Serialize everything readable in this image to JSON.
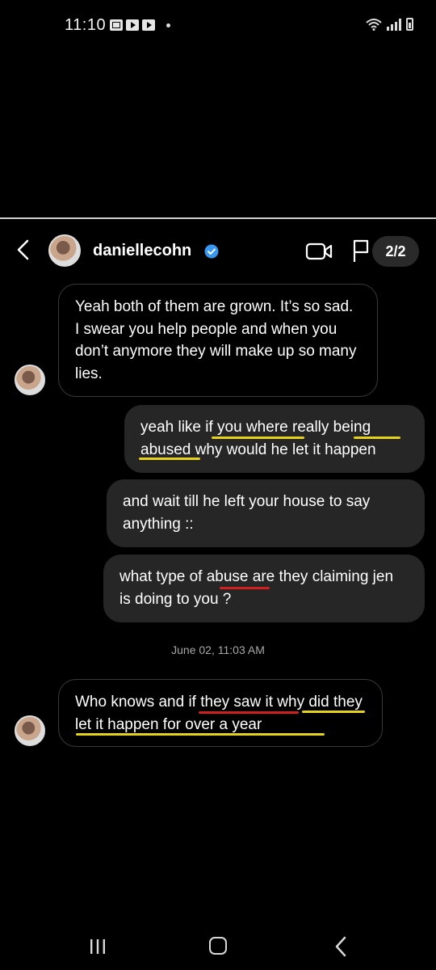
{
  "status_bar": {
    "time": "11:10"
  },
  "header": {
    "username": "daniellecohn",
    "page_counter": "2/2"
  },
  "messages": [
    {
      "direction": "in",
      "text": "Yeah both of them are grown.  It’s so sad.  I swear you help people and when you don’t anymore they will make up so many lies."
    },
    {
      "direction": "out",
      "text": "yeah like if you where really being abused why would he let it happen"
    },
    {
      "direction": "out",
      "text": "and wait till he left your house to say anything ::"
    },
    {
      "direction": "out",
      "text": "what type of abuse are they claiming jen is doing to you ?"
    },
    {
      "direction": "in",
      "text": "Who knows and if they saw it why did they let it happen for over a year"
    }
  ],
  "timestamp": "June 02, 11:03 AM",
  "colors": {
    "background": "#000000",
    "outgoing_bubble": "#262626",
    "incoming_border": "#3a3a3a",
    "verified_blue": "#3897f0",
    "underline_yellow": "#e6d21a",
    "underline_red": "#d41f1f"
  }
}
